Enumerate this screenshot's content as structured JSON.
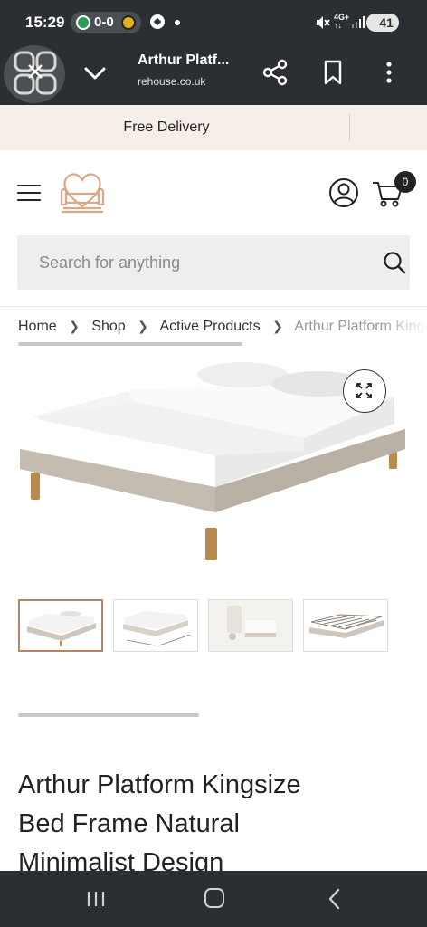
{
  "status_bar": {
    "time": "15:29",
    "score": "0-0",
    "network": [
      "4G+",
      "↑↓"
    ],
    "battery": "41",
    "icons": [
      "football-icon",
      "mute-icon",
      "signal-icon"
    ]
  },
  "tab_bar": {
    "title": "Arthur Platf...",
    "url": "rehouse.co.uk",
    "icons": [
      "app-grid-icon",
      "chevron-down-icon",
      "share-icon",
      "bookmark-icon",
      "more-vert-icon"
    ]
  },
  "promo": {
    "text": "Free Delivery"
  },
  "header": {
    "cart_count": "0",
    "icons": [
      "menu-icon",
      "sofa-heart-logo",
      "account-icon",
      "cart-icon"
    ]
  },
  "search": {
    "placeholder": "Search for anything"
  },
  "breadcrumb": {
    "items": [
      "Home",
      "Shop",
      "Active Products"
    ],
    "current": "Arthur Platform Kingsize Bed Frame Natural Minimalist Design"
  },
  "product": {
    "title_lines": [
      "Arthur Platform Kingsize",
      "Bed Frame Natural",
      "Minimalist Design"
    ],
    "thumbnails": [
      "bed-front-view",
      "bed-dimensions-view",
      "bed-room-view",
      "bed-slats-view"
    ],
    "active_thumbnail": 0
  },
  "colors": {
    "status_bg": "#2b2f33",
    "promo_bg": "#f6efe9",
    "accent": "#b5876a",
    "fabric": "#cfc6bc"
  }
}
